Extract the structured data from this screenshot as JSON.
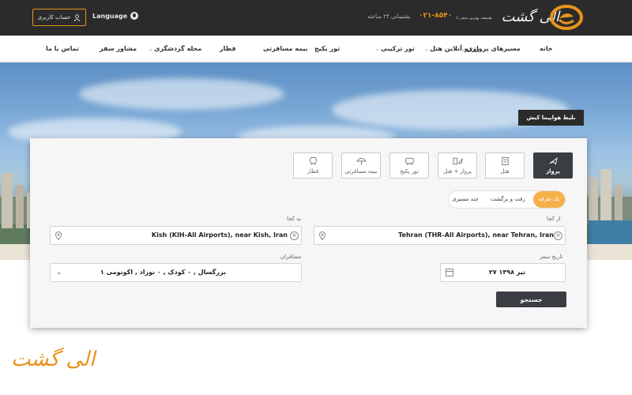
{
  "header": {
    "account_label": "حساب کاربری",
    "language_label": "Language",
    "support_text": "پشتیبانی ۲۴ ساعته",
    "phone": "۰۲۱-۸۵۴۰",
    "brand_name": "الی گشت",
    "brand_tagline": "همیشه بهترین سفر با",
    "accent_color": "#e8931c"
  },
  "nav": {
    "items": [
      {
        "label": "خانه"
      },
      {
        "label": "مسیرهای پروازی",
        "has_menu": true
      },
      {
        "label": "رزرو آنلاین هتل",
        "has_menu": true
      },
      {
        "label": "تور ترکیبی",
        "has_menu": true
      },
      {
        "label": "تور پکیج"
      },
      {
        "label": "بیمه مسافرتی"
      },
      {
        "label": "قطار"
      },
      {
        "label": "مجله گردشگری",
        "has_menu": true
      },
      {
        "label": "مشاور سفر"
      },
      {
        "label": "تماس با ما"
      }
    ]
  },
  "promo_label": "بلیط هواپیما کیش",
  "tabs": [
    {
      "label": "پرواز",
      "icon": "airplane-icon",
      "active": true
    },
    {
      "label": "هتل",
      "icon": "hotel-icon"
    },
    {
      "label": "پرواز + هتل",
      "icon": "flight-hotel-icon"
    },
    {
      "label": "تور پکیج",
      "icon": "bus-icon"
    },
    {
      "label": "بیمه مسافرتی",
      "icon": "umbrella-icon"
    },
    {
      "label": "قطار",
      "icon": "train-icon"
    }
  ],
  "trip_type": {
    "options": [
      "یک طرفه",
      "رفت و برگشت",
      "چند مسیری"
    ],
    "selected": "یک طرفه"
  },
  "form": {
    "from_label": "از کجا",
    "from_value": "Tehran (THR-All Airports), near Tehran, Iran",
    "to_label": "به کجا",
    "to_value": "Kish (KIH-All Airports), near Kish, Iran",
    "date_label": "تاریخ سفر",
    "date_value": "۲۷ تیر ۱۳۹۸",
    "passengers_label": "مسافران",
    "passengers_value": "۱ بزرگسال , ۰ کودک , ۰ نوزاد , اکونومی",
    "search_label": "جستجو"
  },
  "watermark_text": "الی گشت"
}
